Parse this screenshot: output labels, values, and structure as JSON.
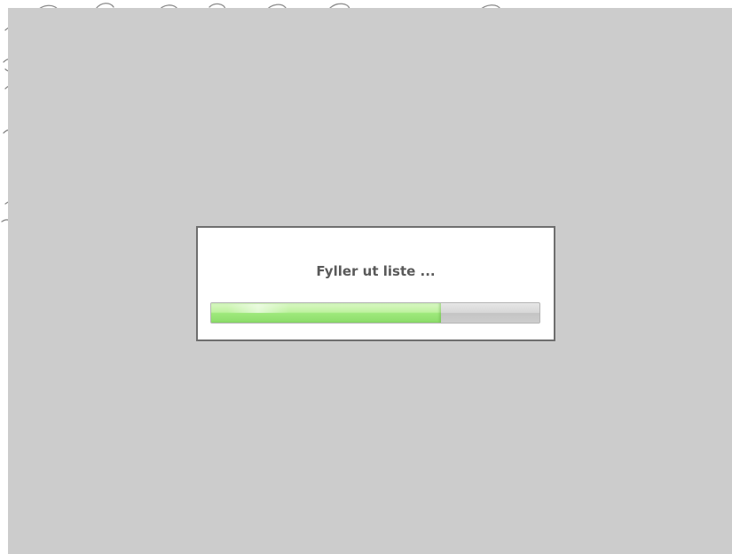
{
  "loading_dialog": {
    "message": "Fyller ut liste ...",
    "progress_fraction": 0.7
  },
  "colors": {
    "backdrop": "#cccccc",
    "dialog_border": "#6e6e6e",
    "progress_fill": "#9ee87c",
    "progress_track": "#cdcdcd",
    "message_text": "#5a5a5a"
  }
}
